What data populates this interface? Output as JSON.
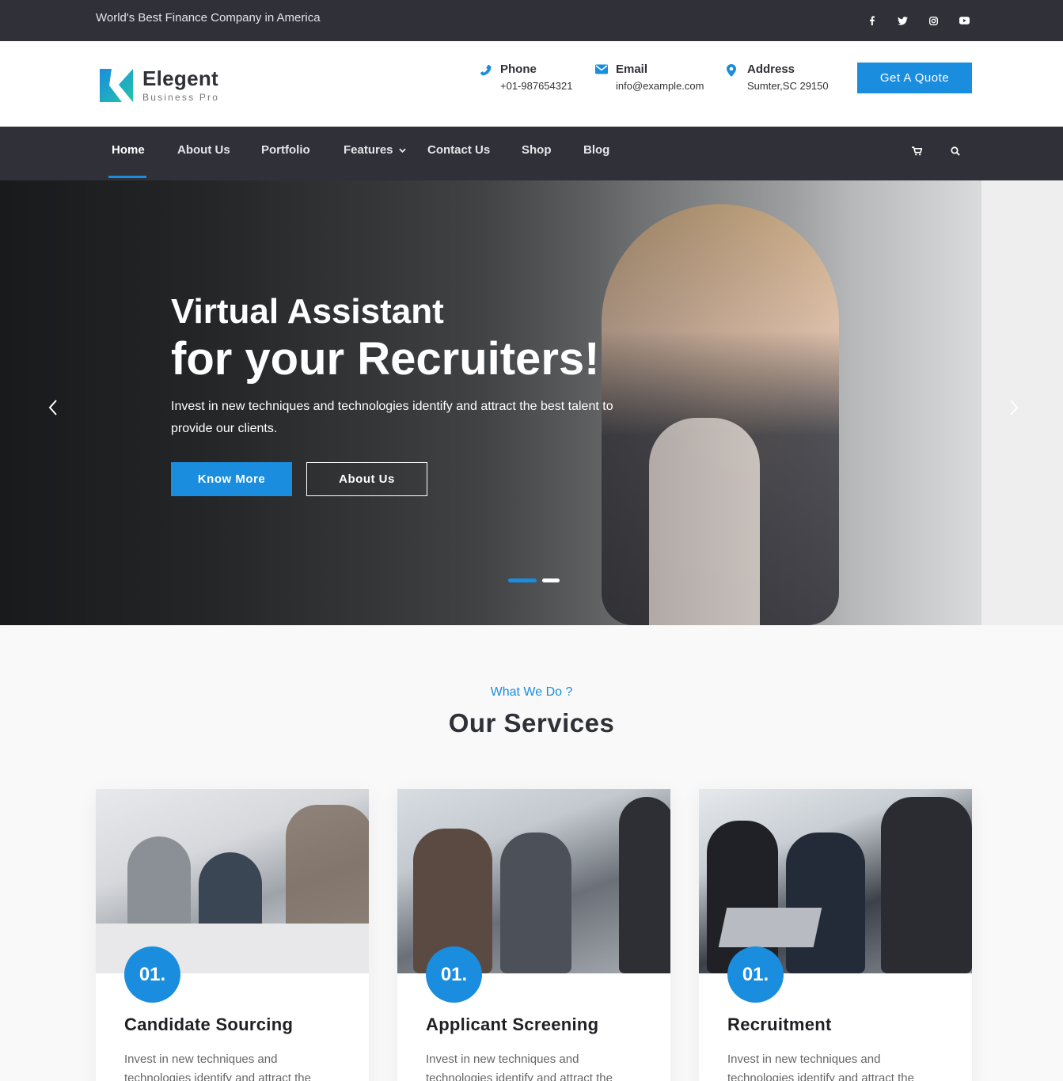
{
  "topbar": {
    "tagline": "World's Best Finance Company in America",
    "socials": [
      "facebook-icon",
      "twitter-icon",
      "instagram-icon",
      "youtube-icon"
    ]
  },
  "logo": {
    "name": "Elegent",
    "tagline": "Business Pro"
  },
  "contacts": [
    {
      "icon": "phone-icon",
      "label": "Phone",
      "value": "+01-987654321"
    },
    {
      "icon": "envelope-icon",
      "label": "Email",
      "value": "info@example.com"
    },
    {
      "icon": "map-pin-icon",
      "label": "Address",
      "value": "Sumter,SC 29150"
    }
  ],
  "header": {
    "quote_button": "Get A Quote"
  },
  "nav": {
    "items": [
      {
        "label": "Home",
        "active": true
      },
      {
        "label": "About Us"
      },
      {
        "label": "Portfolio"
      },
      {
        "label": "Features",
        "dropdown": true
      },
      {
        "label": "Contact Us"
      },
      {
        "label": "Shop"
      },
      {
        "label": "Blog"
      }
    ],
    "icons": [
      "cart-icon",
      "search-icon"
    ]
  },
  "hero": {
    "title_line1": "Virtual Assistant",
    "title_line2": "for your Recruiters!",
    "text": "Invest in new techniques and technologies identify and attract the best talent to provide our clients.",
    "primary_button": "Know More",
    "secondary_button": "About Us",
    "slides": 2,
    "active_slide": 1
  },
  "services": {
    "pretitle": "What We Do ?",
    "title": "Our Services",
    "cards": [
      {
        "number": "01.",
        "title": "Candidate Sourcing",
        "text": "Invest in new techniques and technologies identify and attract the"
      },
      {
        "number": "01.",
        "title": "Applicant Screening",
        "text": "Invest in new techniques and technologies identify and attract the"
      },
      {
        "number": "01.",
        "title": "Recruitment",
        "text": "Invest in new techniques and technologies identify and attract the"
      }
    ]
  },
  "colors": {
    "accent": "#1a8ddf",
    "dark": "#2f3038"
  }
}
